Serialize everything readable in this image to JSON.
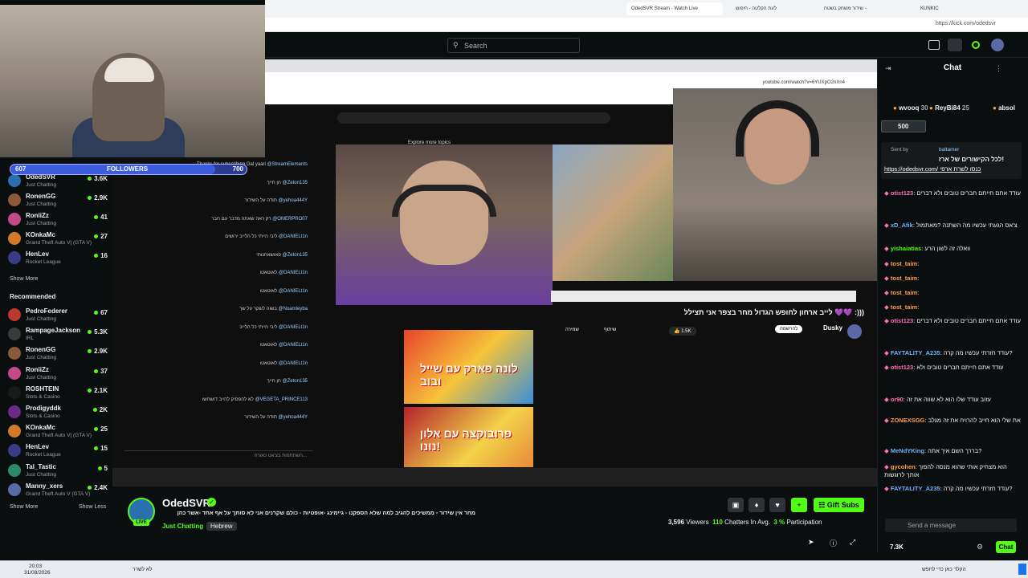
{
  "browser": {
    "tabs": [
      "OdedSVR Stream - Watch Live",
      "לעת הקלטה - חיפוש",
      "שידור משחק בשטח -",
      "KUNKIC"
    ],
    "url": "https://kick.com/odedsvr"
  },
  "search": {
    "placeholder": "Search"
  },
  "overlay": {
    "followers_count": "607",
    "followers_label": "FOLLOWERS",
    "followers_goal": "700",
    "followers_progress": 0.867
  },
  "sidebar": {
    "following": [
      {
        "name": "OdedSVR",
        "category": "Just Chatting",
        "viewers": "3.6K",
        "color": "#2a6fb0"
      },
      {
        "name": "RonenGG",
        "category": "Just Chatting",
        "viewers": "2.9K",
        "color": "#8a5a3a"
      },
      {
        "name": "RoniiZz",
        "category": "Just Chatting",
        "viewers": "41",
        "color": "#c44a8a"
      },
      {
        "name": "KOnkaMc",
        "category": "Grand Theft Auto V| (GTA V)",
        "viewers": "27",
        "color": "#d07a2a"
      },
      {
        "name": "HenLev",
        "category": "Rocket League",
        "viewers": "16",
        "color": "#3a3a8a"
      }
    ],
    "show_more": "Show More",
    "recommended_title": "Recommended",
    "recommended": [
      {
        "name": "PedroFederer",
        "category": "Just Chatting",
        "viewers": "67",
        "color": "#b83a2a"
      },
      {
        "name": "RampageJackson",
        "category": "IRL",
        "viewers": "5.3K",
        "color": "#3a3a3a"
      },
      {
        "name": "RonenGG",
        "category": "Just Chatting",
        "viewers": "2.9K",
        "color": "#8a5a3a"
      },
      {
        "name": "RoniiZz",
        "category": "Just Chatting",
        "viewers": "37",
        "color": "#c44a8a"
      },
      {
        "name": "ROSHTEIN",
        "category": "Slots & Casino",
        "viewers": "2.1K",
        "color": "#1a1a1a"
      },
      {
        "name": "Prodigyddk",
        "category": "Slots & Casino",
        "viewers": "2K",
        "color": "#6a2a8a"
      },
      {
        "name": "KOnkaMc",
        "category": "Grand Theft Auto V| (GTA V)",
        "viewers": "25",
        "color": "#d07a2a"
      },
      {
        "name": "HenLev",
        "category": "Rocket League",
        "viewers": "15",
        "color": "#3a3a8a"
      },
      {
        "name": "Tal_Tastic",
        "category": "Just Chatting",
        "viewers": "5",
        "color": "#2a8a6a"
      },
      {
        "name": "Manny_xers",
        "category": "Grand Theft Auto V (GTA V)",
        "viewers": "2.4K",
        "color": "#5a6aa8"
      }
    ],
    "show_more2": "Show More",
    "show_less": "Show Less"
  },
  "video": {
    "yt_url": "youtube.com/watch?v=6YUXpO2nXn4",
    "title": "לייב ארחון לחופש הגדול מחר בצפר אני תצילל 💜💜 :)))",
    "channel": "Dusky",
    "thumb1_text": "לונה פארק עם שייל ובוב",
    "thumb2_text": "פרובוקצה עם אלון נונו!",
    "subscribe": "להרשמה",
    "likes": "1.5K",
    "share": "שיתוף",
    "save": "שמירה",
    "explore": "Explore more topics",
    "left_chat": [
      {
        "user": "@StreamElements",
        "text": "Thanks for subscribing Gal yaari"
      },
      {
        "user": "@Zeton135",
        "text": "חן חייך"
      },
      {
        "user": "@yehoa444Y",
        "text": "תודה על השידור"
      },
      {
        "user": "@OMERPRO07",
        "text": "רק ראה שאתה מדבר עם חבר"
      },
      {
        "user": "@DANIELt1n",
        "text": "ליבי הייתי כל הלייב ירושים"
      },
      {
        "user": "@Zeton135",
        "text": "פאושאחנותי"
      },
      {
        "user": "@DANIELt1n",
        "text": "לאוטאטו"
      },
      {
        "user": "@DANIELt1n",
        "text": "לאוטאטו"
      },
      {
        "user": "@Noamleyba",
        "text": "בשוה לשקר על שך"
      },
      {
        "user": "@DANIELt1n",
        "text": "ליבי הייתי כל הלייב"
      },
      {
        "user": "@DANIELt1n",
        "text": "לאוטאטו"
      },
      {
        "user": "@DANIELt1n",
        "text": "לאוטאטו"
      },
      {
        "user": "@Zeton135",
        "text": "חן חייך"
      },
      {
        "user": "@VEGETA_PRINCE113",
        "text": "לא להפסיק להייב דושחשו"
      },
      {
        "user": "@yehoa444Y",
        "text": "תודה על השידור"
      }
    ],
    "chat_input_placeholder": "השתתפות בצ'אט כאורח..."
  },
  "stream": {
    "streamer": "OdedSVR",
    "live": "LIVE",
    "title": "מחר אין שידור - ממשיכים להגיב למה שלא הספקנו - גיימינג -אופטיות - כולם שקרנים אני לא סותך על אף אחד -אשר כהן",
    "category": "Just Chatting",
    "tag": "Hebrew",
    "viewers": "3,596",
    "viewers_label": "Viewers",
    "chatters": "110",
    "chatters_label": "Chatters In Avg.",
    "participation": "3 %",
    "participation_label": "Participation",
    "gift_subs": "Gift Subs"
  },
  "chat": {
    "title": "Chat",
    "top_gifters": [
      {
        "name": "wvooq",
        "count": "30"
      },
      {
        "name": "ReyBi84",
        "count": "25"
      },
      {
        "name": "absol",
        "count": ""
      }
    ],
    "kicks": "500",
    "pinned_by": "Sent by",
    "pinned_user": "baltamer",
    "pinned_text": "לכל הקישורים של ארז!",
    "pinned_link": "https://odedsvr.com/ כנסו לשרת ארפי",
    "messages": [
      {
        "user": "otist123",
        "text": "עודד אתם חייתם חברים טובים ולא דברים",
        "color": "#ff6fb5"
      },
      {
        "user": "xD_Afik",
        "text": "צ'אס הגעתי עכשיו מה השתנה ?מאתמול",
        "color": "#6fb5ff"
      },
      {
        "user": "yishaiatias",
        "text": "וואלה זה לשון הרע",
        "color": "#53fc18"
      },
      {
        "user": "tost_taim",
        "text": "",
        "color": "#ff9f4a"
      },
      {
        "user": "tost_taim",
        "text": "",
        "color": "#ff9f4a"
      },
      {
        "user": "tost_taim",
        "text": "",
        "color": "#ff9f4a"
      },
      {
        "user": "tost_taim",
        "text": "",
        "color": "#ff9f4a"
      },
      {
        "user": "otist123",
        "text": "עודד אתם חייתם חברים טובים ולא דברים",
        "color": "#ff6fb5"
      },
      {
        "user": "FAYTALITY_A235",
        "text": "עודד חזרתי עכשיו מה קרה?",
        "color": "#6fb5ff"
      },
      {
        "user": "otist123",
        "text": "עודד אתם חייתם חברים טובים ולא",
        "color": "#ff6fb5"
      },
      {
        "user": "or90",
        "text": "עזוב עודד שלו הוא לא שווה את זה",
        "color": "#ff6fb5"
      },
      {
        "user": "ZONEXSGG",
        "text": "את שלי הוא חייב להרויח את זה מגלב",
        "color": "#ff9f4a"
      },
      {
        "user": "MeNdYKing",
        "text": "בררך השם איך אתה?",
        "color": "#6fb5ff"
      },
      {
        "user": "gycohen",
        "text": "הוא מצחיק אותי שהוא מנסה להפוך אותך לרוגשות",
        "color": "#ff9f4a"
      },
      {
        "user": "FAYTALITY_A235",
        "text": "עודד חזרתי עכשיו מה קרה?",
        "color": "#6fb5ff"
      }
    ],
    "input_placeholder": "Send a message",
    "points": "7.3K",
    "send": "Chat"
  },
  "taskbar": {
    "time": "20:03",
    "date": "31/08/2026",
    "search": "הקלד כאן כדי לחפש",
    "weather": "לא לשרר"
  },
  "colors": {
    "accent": "#53fc18",
    "bg": "#0b0e0f"
  }
}
